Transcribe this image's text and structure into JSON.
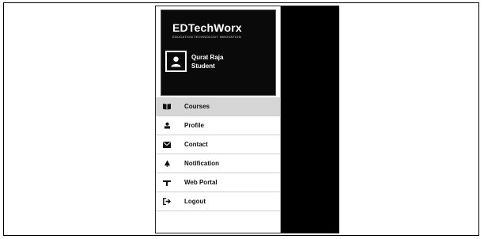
{
  "brand": {
    "title": "EDTechWorx",
    "tagline": "EDUCATION  TECHNOLOGY  INNOVATION"
  },
  "user": {
    "name": "Qurat Raja",
    "role": "Student",
    "avatar_icon": "person-icon"
  },
  "menu": {
    "active_index": 0,
    "items": [
      {
        "label": "Courses",
        "icon": "book-open-icon"
      },
      {
        "label": "Profile",
        "icon": "person-icon"
      },
      {
        "label": "Contact",
        "icon": "envelope-icon"
      },
      {
        "label": "Notification",
        "icon": "bell-icon"
      },
      {
        "label": "Web Portal",
        "icon": "portal-icon"
      },
      {
        "label": "Logout",
        "icon": "logout-icon"
      }
    ]
  },
  "colors": {
    "header_bg": "#0a0a0a",
    "active_item_bg": "#d6d6d6",
    "overlay_bg": "#000000"
  }
}
